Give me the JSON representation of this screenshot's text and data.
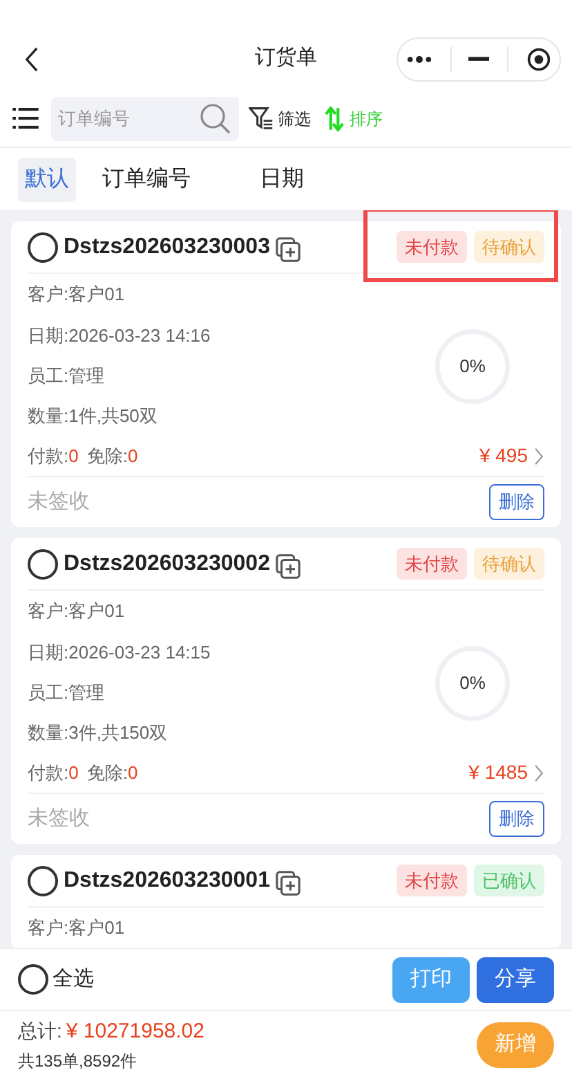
{
  "nav": {
    "title": "订货单"
  },
  "toolbar": {
    "search": {
      "placeholder": "订单编号"
    },
    "filter": "筛选",
    "sort": "排序"
  },
  "sort_tabs": [
    {
      "label": "默认",
      "selected": true
    },
    {
      "label": "订单编号",
      "selected": false
    },
    {
      "label": "日期",
      "selected": false
    }
  ],
  "orders": [
    {
      "id": "Dstzs202603230003",
      "selected": false,
      "highlighted": true,
      "tags": [
        {
          "label": "未付款",
          "kind": "unpaid"
        },
        {
          "label": "待确认",
          "kind": "pending"
        }
      ],
      "customer": "客户:客户01",
      "date": "日期:2026-03-23 14:16",
      "staff": "员工:管理",
      "quantity": "数量:1件,共50双",
      "paid_label": "付款:",
      "paid": "0",
      "waived_label": "免除:",
      "waived": "0",
      "amount": "¥ 495",
      "progress": {
        "text": "0%"
      },
      "sign_status": "未签收",
      "delete": "删除"
    },
    {
      "id": "Dstzs202603230002",
      "selected": false,
      "highlighted": false,
      "tags": [
        {
          "label": "未付款",
          "kind": "unpaid"
        },
        {
          "label": "待确认",
          "kind": "pending"
        }
      ],
      "customer": "客户:客户01",
      "date": "日期:2026-03-23 14:15",
      "staff": "员工:管理",
      "quantity": "数量:3件,共150双",
      "paid_label": "付款:",
      "paid": "0",
      "waived_label": "免除:",
      "waived": "0",
      "amount": "¥ 1485",
      "progress": {
        "text": "0%"
      },
      "sign_status": "未签收",
      "delete": "删除"
    },
    {
      "id": "Dstzs202603230001",
      "selected": false,
      "highlighted": false,
      "tags": [
        {
          "label": "未付款",
          "kind": "unpaid"
        },
        {
          "label": "已确认",
          "kind": "confirmed"
        }
      ],
      "customer": "客户:客户01"
    }
  ],
  "footer": {
    "select_all": {
      "label": "全选",
      "checked": false
    },
    "print": "打印",
    "share": "分享",
    "total_label": "总计:",
    "total": "¥ 10271958.02",
    "summary": "共135单,8592件",
    "add": "新增"
  }
}
